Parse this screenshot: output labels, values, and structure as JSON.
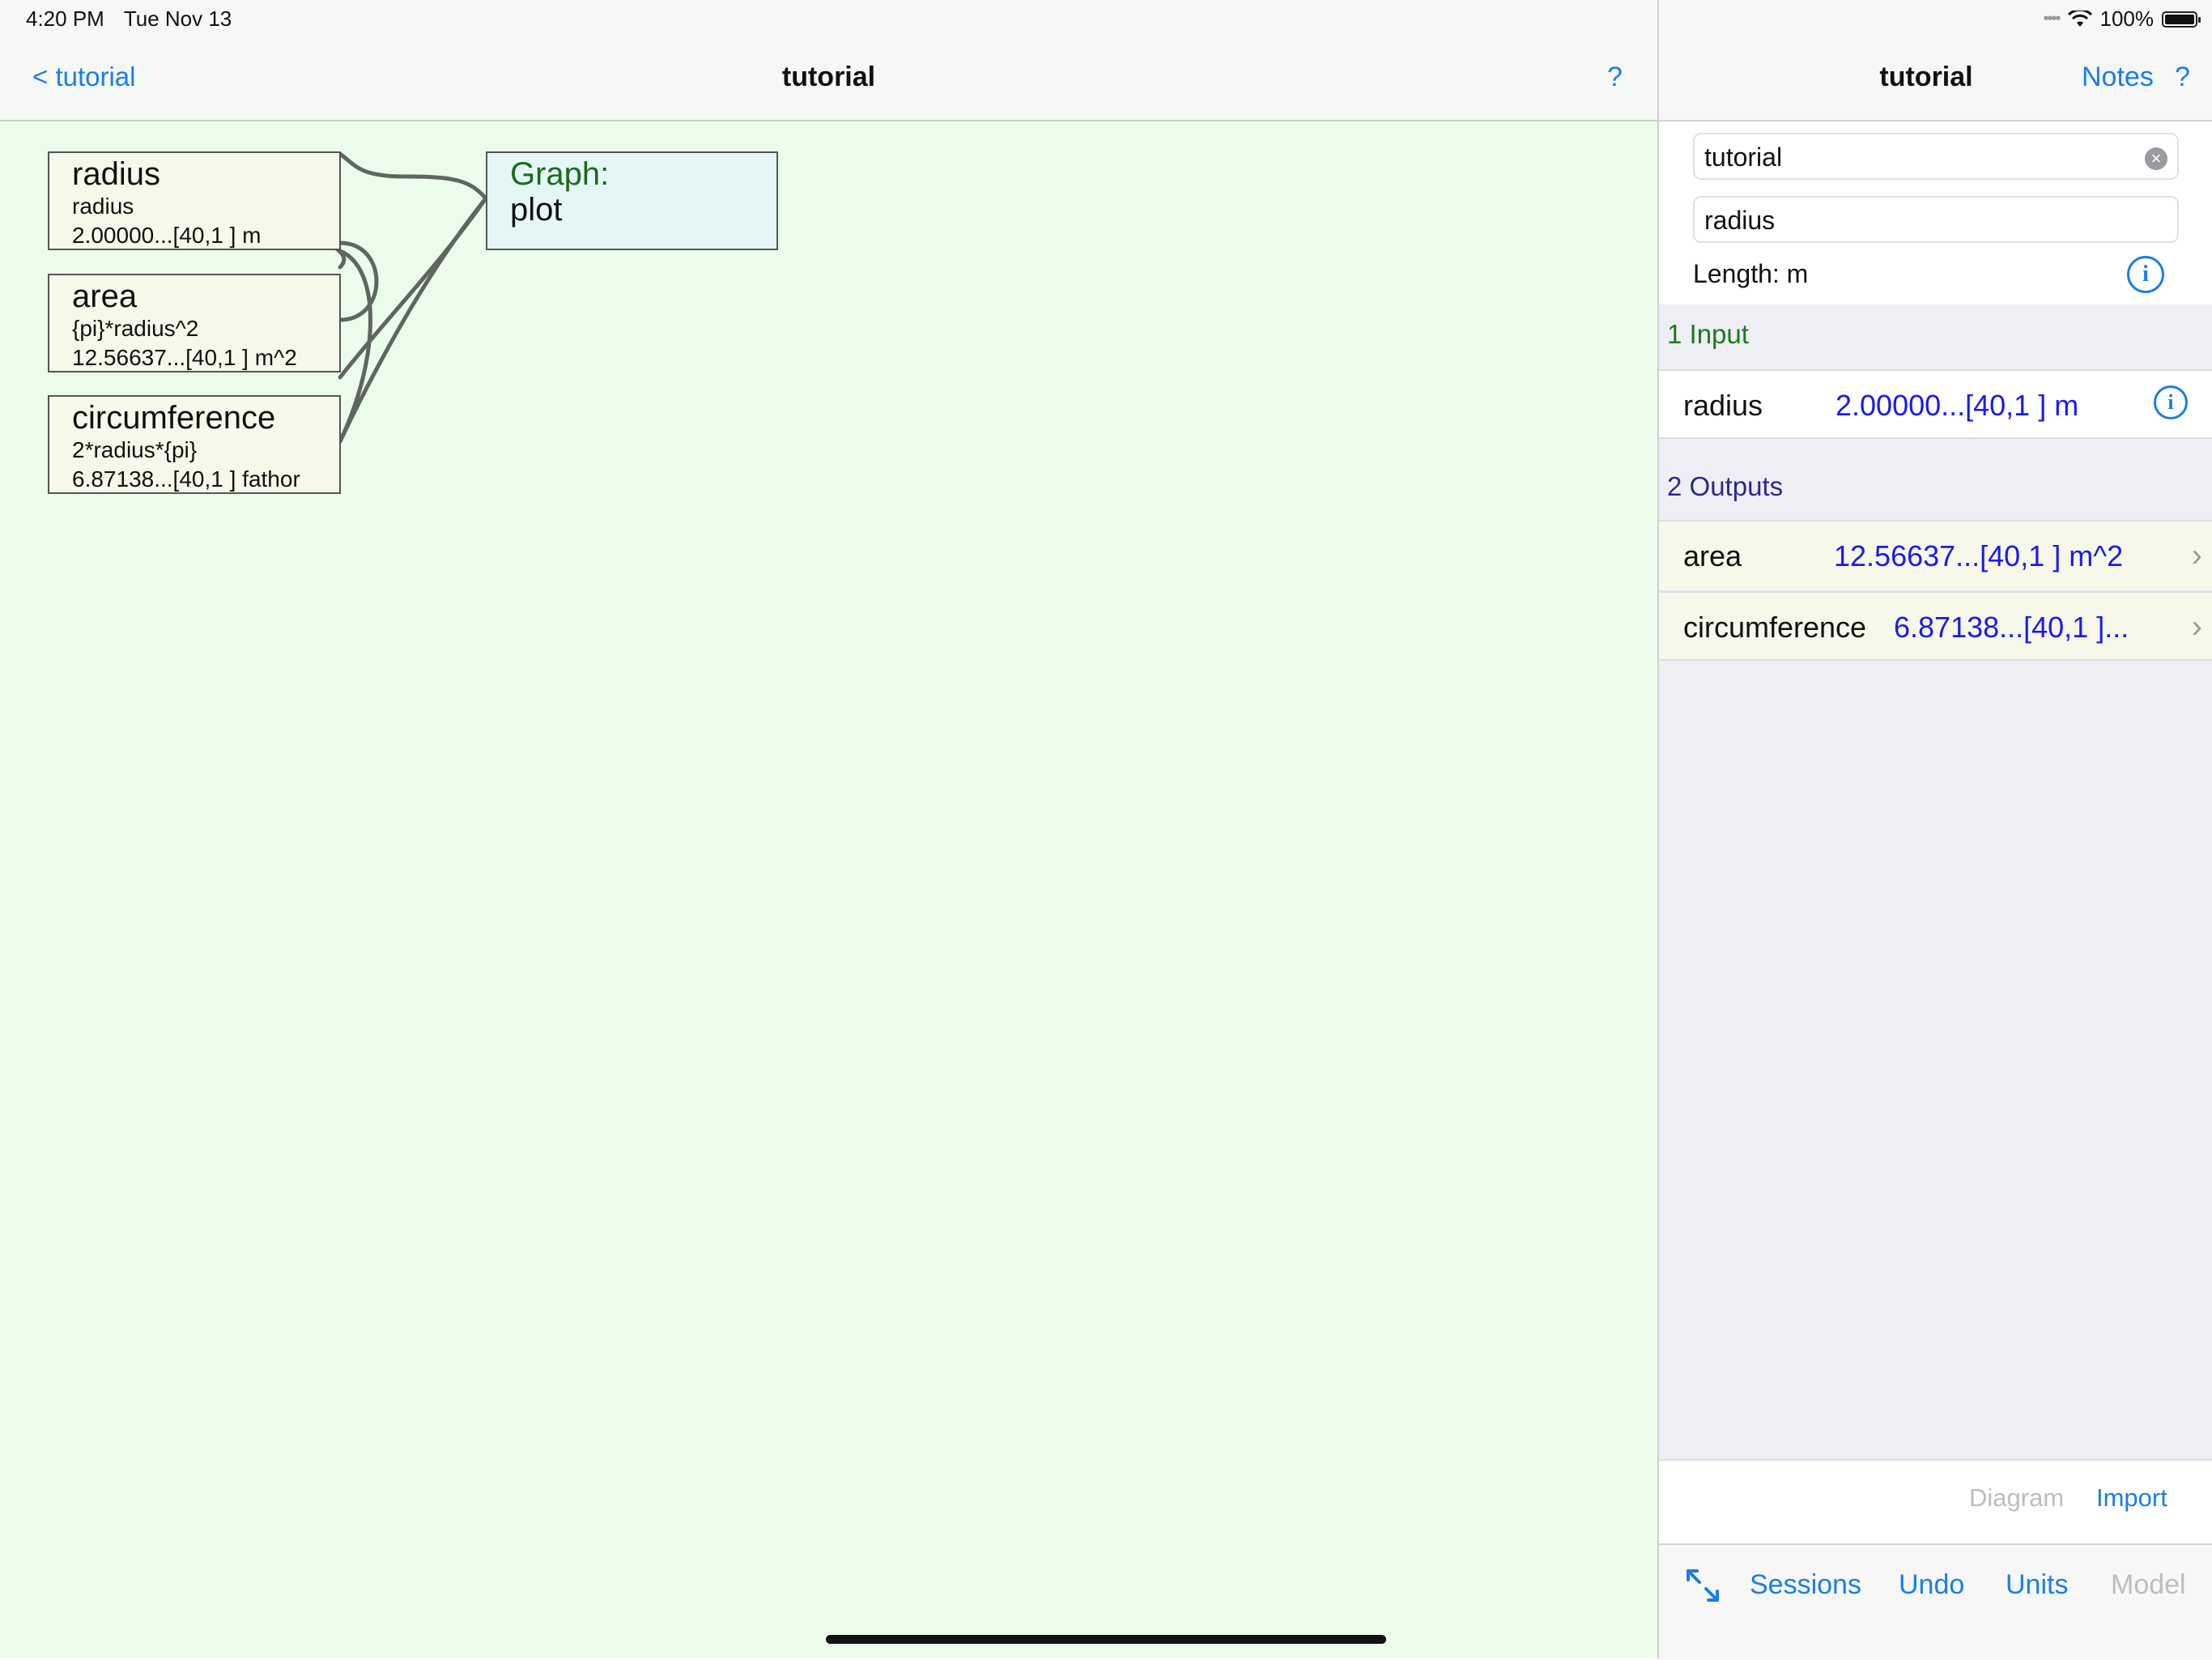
{
  "status_bar": {
    "time": "4:20 PM",
    "date": "Tue Nov 13",
    "battery": "100%"
  },
  "left_pane": {
    "back_label": "< tutorial",
    "title": "tutorial",
    "help_label": "?"
  },
  "diagram": {
    "nodes": [
      {
        "title": "radius",
        "line1": "radius",
        "line2": "2.00000...[40,1 ] m"
      },
      {
        "title": "area",
        "line1": "{pi}*radius^2",
        "line2": "12.56637...[40,1 ] m^2"
      },
      {
        "title": "circumference",
        "line1": "2*radius*{pi}",
        "line2": "6.87138...[40,1 ] fathor"
      }
    ],
    "graph_node": {
      "label": "Graph:",
      "name": "plot"
    }
  },
  "right_pane": {
    "title": "tutorial",
    "notes_label": "Notes",
    "help_label": "?",
    "session_field": "tutorial",
    "variable_field": "radius",
    "length_label": "Length: m",
    "input_header": "1 Input",
    "inputs": [
      {
        "name": "radius",
        "value": "2.00000...[40,1 ] m"
      }
    ],
    "output_header": "2 Outputs",
    "outputs": [
      {
        "name": "area",
        "value": "12.56637...[40,1 ] m^2"
      },
      {
        "name": "circumference",
        "value": "6.87138...[40,1 ]..."
      }
    ],
    "diagram_label": "Diagram",
    "import_label": "Import",
    "toolbar": {
      "sessions": "Sessions",
      "undo": "Undo",
      "units": "Units",
      "model": "Model"
    }
  },
  "colors": {
    "accent": "#1a7ee8",
    "canvas_bg": "#ebfdea",
    "value_blue": "#1a1aee",
    "input_green": "#1b7a1b",
    "output_navy": "#2a2a8c"
  }
}
